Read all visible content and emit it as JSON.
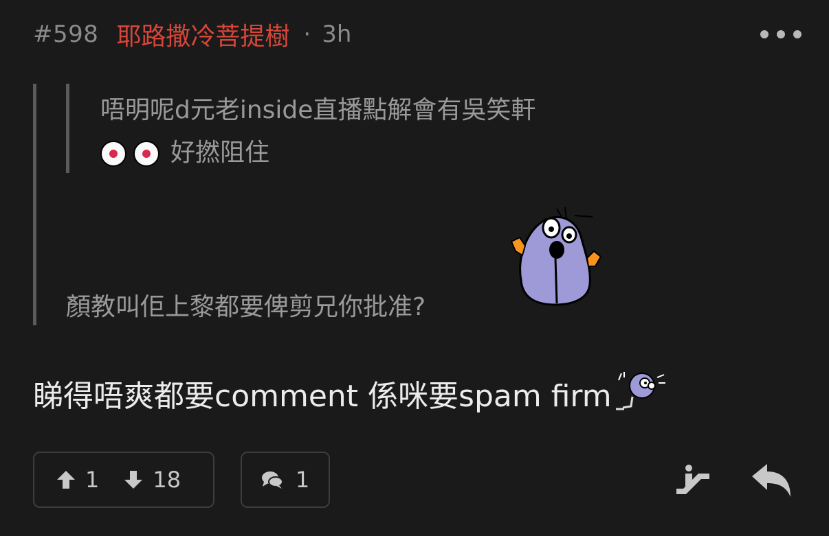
{
  "header": {
    "post_number": "#598",
    "username": "耶路撒冷菩提樹",
    "separator": "·",
    "time": "3h"
  },
  "nested_quote": {
    "line1": "唔明呢d元老inside直播點解會有吳笑軒",
    "line2_suffix": "好撚阻住",
    "emoji_icons": [
      "clown-face-sticker",
      "clown-face-sticker"
    ]
  },
  "quote": {
    "text": "顏教叫佢上黎都要俾剪兄你批准?",
    "sticker": "purple-blob-sticker"
  },
  "post": {
    "text": "睇得唔爽都要comment 係咪要spam firm",
    "sticker": "small-purple-blob-sticker"
  },
  "actions": {
    "upvotes": "1",
    "downvotes": "18",
    "replies": "1"
  },
  "colors": {
    "background": "#1a1a1a",
    "username": "#d8463a",
    "muted_text": "#8b8b8b",
    "sticker_purple": "#9e9ad8"
  }
}
